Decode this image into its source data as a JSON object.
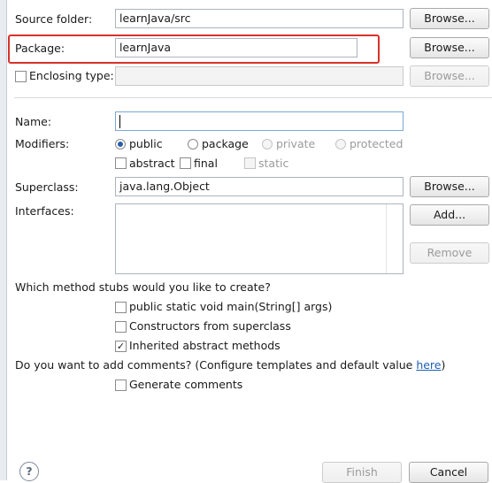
{
  "source_folder": {
    "label": "Source folder:",
    "value": "learnJava/src",
    "browse": "Browse..."
  },
  "package": {
    "label": "Package:",
    "value": "learnJava",
    "browse": "Browse..."
  },
  "enclosing_type": {
    "label": "Enclosing type:",
    "value": "",
    "browse": "Browse...",
    "checked": false
  },
  "name": {
    "label": "Name:",
    "value": ""
  },
  "modifiers": {
    "label": "Modifiers:",
    "radios": [
      {
        "label": "public",
        "checked": true,
        "enabled": true
      },
      {
        "label": "package",
        "checked": false,
        "enabled": true
      },
      {
        "label": "private",
        "checked": false,
        "enabled": false
      },
      {
        "label": "protected",
        "checked": false,
        "enabled": false
      }
    ],
    "checks": [
      {
        "label": "abstract",
        "checked": false,
        "enabled": true
      },
      {
        "label": "final",
        "checked": false,
        "enabled": true
      },
      {
        "label": "static",
        "checked": false,
        "enabled": false
      }
    ]
  },
  "superclass": {
    "label": "Superclass:",
    "value": "java.lang.Object",
    "browse": "Browse..."
  },
  "interfaces": {
    "label": "Interfaces:",
    "add": "Add...",
    "remove": "Remove"
  },
  "stubs": {
    "question": "Which method stubs would you like to create?",
    "items": [
      {
        "label": "public static void main(String[] args)",
        "checked": false
      },
      {
        "label": "Constructors from superclass",
        "checked": false
      },
      {
        "label": "Inherited abstract methods",
        "checked": true
      }
    ]
  },
  "comments": {
    "question": "Do you want to add comments? (Configure templates and default value ",
    "link": "here",
    "suffix": ")",
    "generate": {
      "label": "Generate comments",
      "checked": false
    }
  },
  "footer": {
    "help": "?",
    "finish": "Finish",
    "cancel": "Cancel"
  },
  "colors": {
    "highlight": "#d8322a",
    "link": "#1f5fb5"
  }
}
